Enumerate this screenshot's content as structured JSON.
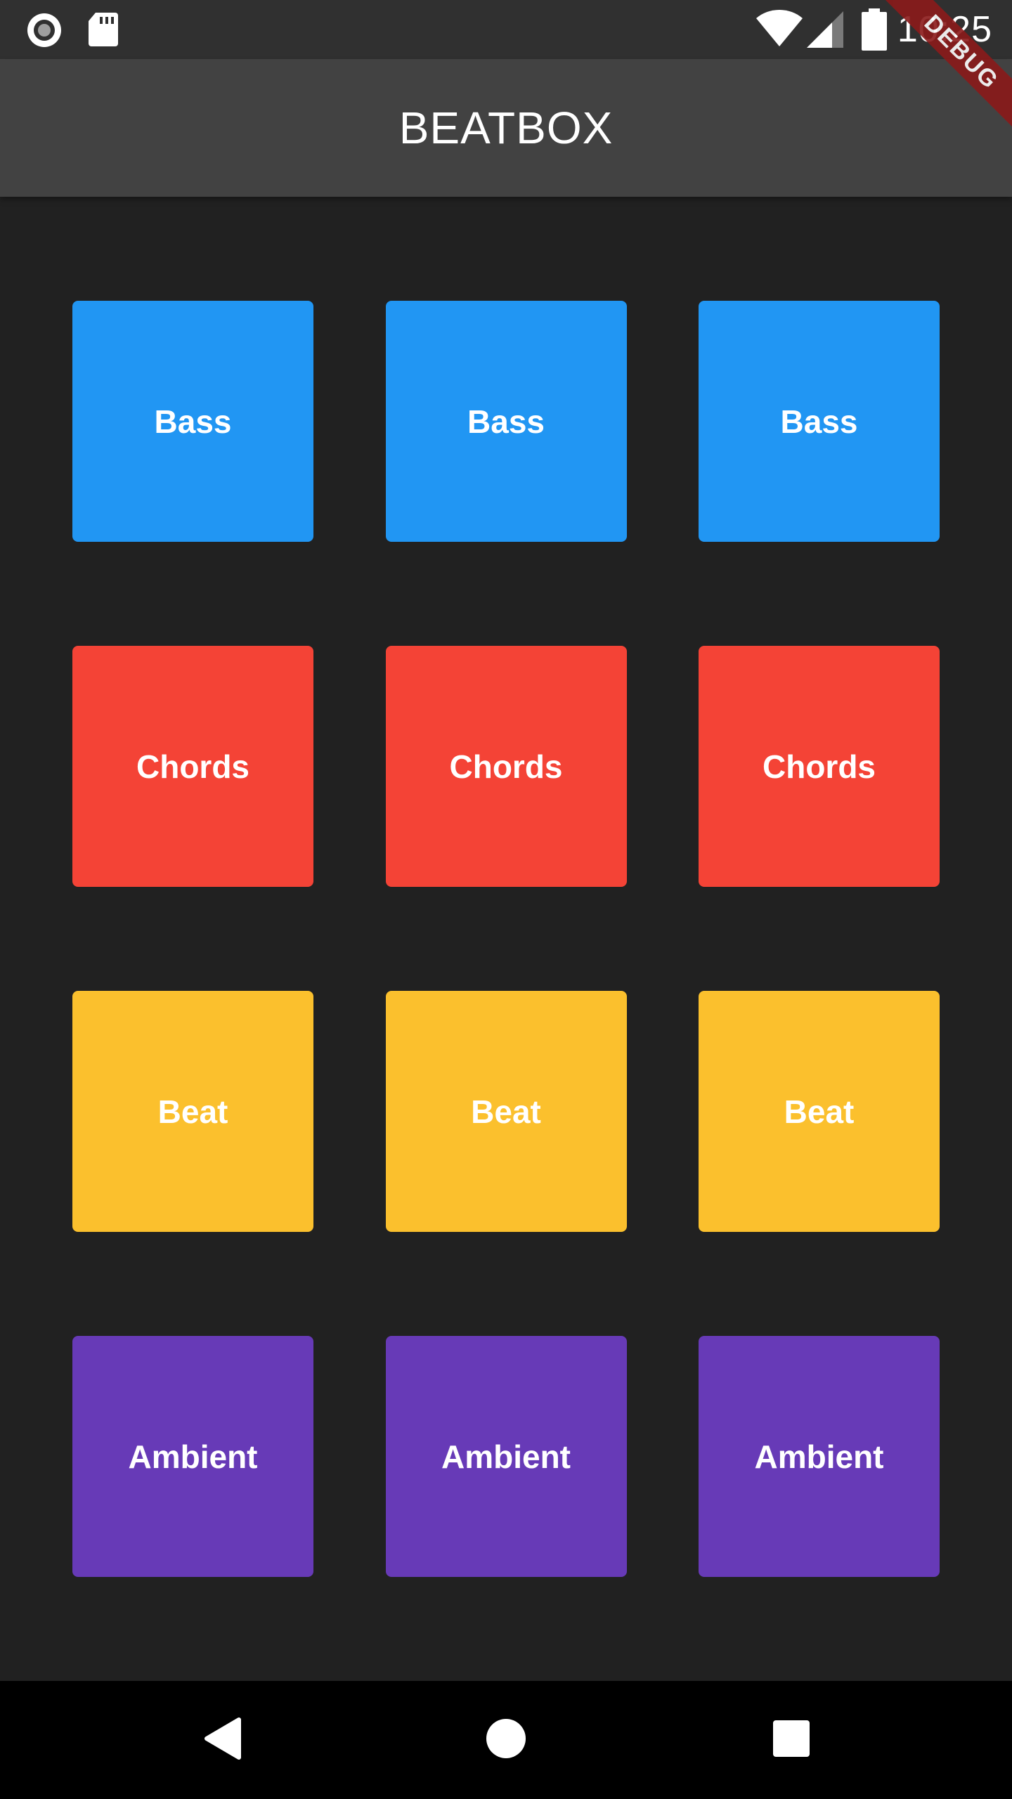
{
  "status_bar": {
    "time": "10:25",
    "icons": [
      "record-icon",
      "sd-card-icon",
      "wifi-icon",
      "cell-signal-icon",
      "battery-icon"
    ]
  },
  "app_bar": {
    "title": "BEATBOX"
  },
  "debug_banner": {
    "label": "DEBUG",
    "color": "#8b1a1a"
  },
  "pads": {
    "rows": [
      {
        "color": "#2196f3",
        "labels": [
          "Bass",
          "Bass",
          "Bass"
        ]
      },
      {
        "color": "#f44336",
        "labels": [
          "Chords",
          "Chords",
          "Chords"
        ]
      },
      {
        "color": "#fbc02d",
        "labels": [
          "Beat",
          "Beat",
          "Beat"
        ]
      },
      {
        "color": "#673ab7",
        "labels": [
          "Ambient",
          "Ambient",
          "Ambient"
        ]
      }
    ]
  },
  "nav_bar": {
    "icons": [
      "back-icon",
      "home-icon",
      "recents-icon"
    ]
  }
}
